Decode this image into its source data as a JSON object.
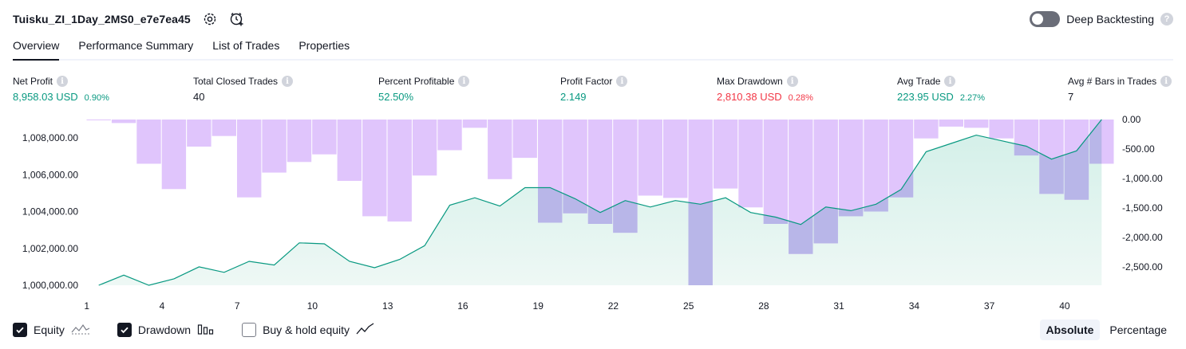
{
  "header": {
    "title": "Tuisku_ZI_1Day_2MS0_e7e7ea45",
    "deep_backtesting_label": "Deep Backtesting",
    "deep_backtesting_on": false,
    "help_glyph": "?"
  },
  "tabs": [
    {
      "label": "Overview",
      "active": true
    },
    {
      "label": "Performance Summary",
      "active": false
    },
    {
      "label": "List of Trades",
      "active": false
    },
    {
      "label": "Properties",
      "active": false
    }
  ],
  "stats": {
    "info_glyph": "i",
    "net_profit": {
      "label": "Net Profit",
      "value": "8,958.03 USD",
      "pct": "0.90%"
    },
    "total_closed_trades": {
      "label": "Total Closed Trades",
      "value": "40"
    },
    "percent_profitable": {
      "label": "Percent Profitable",
      "value": "52.50%"
    },
    "profit_factor": {
      "label": "Profit Factor",
      "value": "2.149"
    },
    "max_drawdown": {
      "label": "Max Drawdown",
      "value": "2,810.38 USD",
      "pct": "0.28%"
    },
    "avg_trade": {
      "label": "Avg Trade",
      "value": "223.95 USD",
      "pct": "2.27%"
    },
    "avg_bars": {
      "label": "Avg # Bars in Trades",
      "value": "7"
    }
  },
  "chart_data": {
    "type": "area",
    "x_ticks": [
      "1",
      "4",
      "7",
      "10",
      "13",
      "16",
      "19",
      "22",
      "25",
      "28",
      "31",
      "34",
      "37",
      "40"
    ],
    "left_axis": {
      "ticks": [
        "1,000,000.00",
        "1,002,000.00",
        "1,004,000.00",
        "1,006,000.00",
        "1,008,000.00"
      ],
      "ylim": [
        1000000,
        1009000
      ]
    },
    "right_axis": {
      "ticks": [
        "0.00",
        "-500.00",
        "-1,000.00",
        "-1,500.00",
        "-2,000.00",
        "-2,500.00"
      ],
      "ylim": [
        -2810.38,
        0
      ]
    },
    "x": [
      1,
      2,
      3,
      4,
      5,
      6,
      7,
      8,
      9,
      10,
      11,
      12,
      13,
      14,
      15,
      16,
      17,
      18,
      19,
      20,
      21,
      22,
      23,
      24,
      25,
      26,
      27,
      28,
      29,
      30,
      31,
      32,
      33,
      34,
      35,
      36,
      37,
      38,
      39,
      40,
      41
    ],
    "series": [
      {
        "name": "Equity",
        "color": "#089981",
        "fill": "#d2efe8",
        "values": [
          1000000,
          1000550,
          1000000,
          1000350,
          1001000,
          1000700,
          1001300,
          1001100,
          1002300,
          1002250,
          1001300,
          1000950,
          1001400,
          1002150,
          1004350,
          1004750,
          1004300,
          1005300,
          1005300,
          1004700,
          1003950,
          1004600,
          1004250,
          1004600,
          1004400,
          1004750,
          1003950,
          1003700,
          1003300,
          1004250,
          1004050,
          1004400,
          1005200,
          1007250,
          1007700,
          1008150,
          1007850,
          1007550,
          1006850,
          1007300,
          1009000
        ]
      },
      {
        "name": "Drawdown",
        "color": "#b39ddb",
        "fill": "#e0c5fc",
        "overlap_fill": "#b8b6e8",
        "values": [
          -10,
          -60,
          -750,
          -1180,
          -460,
          -280,
          -1320,
          -900,
          -720,
          -590,
          -1040,
          -1640,
          -1730,
          -950,
          -520,
          -140,
          -1010,
          -650,
          -1750,
          -1590,
          -1770,
          -1920,
          -1290,
          -1330,
          -2810,
          -1170,
          -1490,
          -1770,
          -2280,
          -2100,
          -1640,
          -1560,
          -1320,
          -320,
          -120,
          -140,
          -320,
          -610,
          -1260,
          -1360,
          -750
        ]
      }
    ],
    "grid": false
  },
  "legend": [
    {
      "label": "Equity",
      "checked": true,
      "icon": "equity-line-icon"
    },
    {
      "label": "Drawdown",
      "checked": true,
      "icon": "drawdown-bars-icon"
    },
    {
      "label": "Buy & hold equity",
      "checked": false,
      "icon": "buy-hold-line-icon"
    }
  ],
  "modes": [
    {
      "label": "Absolute",
      "active": true
    },
    {
      "label": "Percentage",
      "active": false
    }
  ]
}
